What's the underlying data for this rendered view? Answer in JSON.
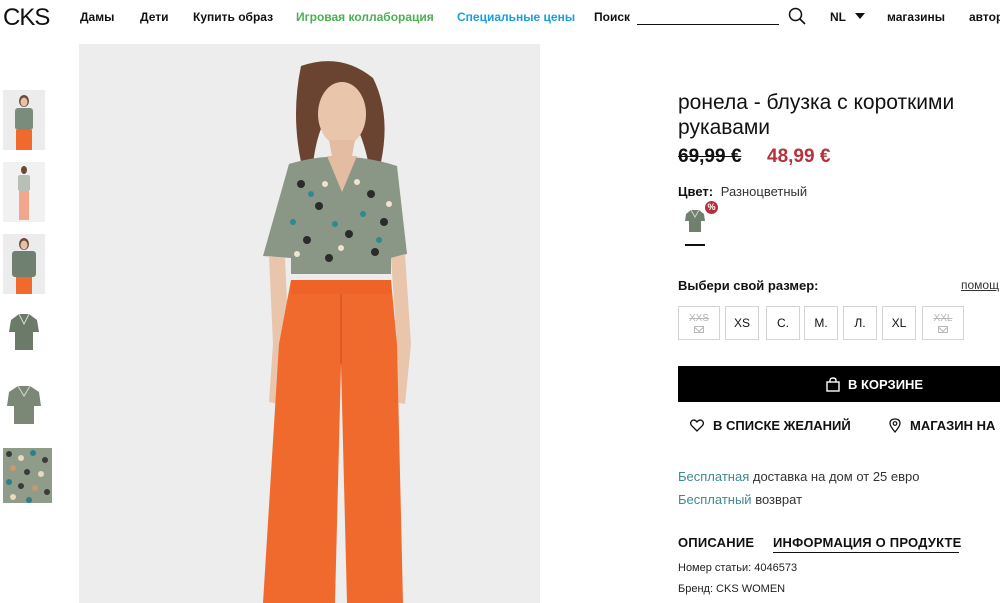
{
  "header": {
    "logo": "CKS",
    "nav": {
      "women": "Дамы",
      "kids": "Дети",
      "shop_look": "Купить образ",
      "game_collab": "Игровая коллаборация",
      "special_prices": "Специальные цены"
    },
    "search_label": "Поиск",
    "lang": "NL",
    "stores": "магазины",
    "login": "автор"
  },
  "product": {
    "title": "ронела - блузка с короткими рукавами",
    "old_price": "69,99 €",
    "new_price": "48,99 €",
    "color_label": "Цвет:",
    "color_value": "Разноцветный",
    "discount_badge": "%",
    "size_label": "Выбери свой размер:",
    "size_help": "помощ",
    "sizes": [
      {
        "label": "XXS",
        "available": false
      },
      {
        "label": "XS",
        "available": true
      },
      {
        "label": "С.",
        "available": true
      },
      {
        "label": "М.",
        "available": true
      },
      {
        "label": "Л.",
        "available": true
      },
      {
        "label": "XL",
        "available": true
      },
      {
        "label": "XXL",
        "available": false
      }
    ],
    "add_to_cart": "В КОРЗИНЕ",
    "wishlist": "В СПИСКЕ ЖЕЛАНИЙ",
    "store_stock": "МАГАЗИН НА",
    "shipping_free": "Бесплатная",
    "shipping_rest": "доставка на дом от 25 евро",
    "return_free": "Бесплатный",
    "return_rest": "возврат"
  },
  "tabs": {
    "description": "ОПИСАНИЕ",
    "product_info": "ИНФОРМАЦИЯ О ПРОДУКТЕ"
  },
  "details": {
    "article": "Номер статьи: 4046573",
    "brand": "Бренд: CKS WOMEN"
  },
  "colors": {
    "sale_red": "#b5323a",
    "teal_link": "#3e8a8f",
    "nav_green": "#4caf50",
    "nav_blue": "#1aa0d8",
    "trousers_orange": "#f06a2e"
  }
}
